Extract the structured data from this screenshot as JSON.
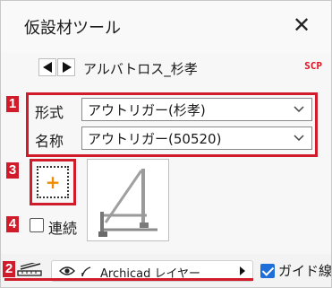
{
  "window": {
    "title": "仮設材ツール",
    "close_glyph": "✕"
  },
  "nav": {
    "item_name": "アルバトロス_杉孝",
    "scp_label": "SCP"
  },
  "markers": [
    "1",
    "2",
    "3",
    "4"
  ],
  "fields": [
    {
      "label": "形式",
      "value": "アウトリガー(杉孝)"
    },
    {
      "label": "名称",
      "value": "アウトリガー(50520)"
    }
  ],
  "add_button": {
    "glyph": "+"
  },
  "continuous": {
    "label": "連続",
    "checked": false
  },
  "bottom": {
    "layer_value": "Archicad レイヤー",
    "guide_label": "ガイド線",
    "guide_checked": true
  },
  "colors": {
    "marker_red": "#d01c2a",
    "scp_red": "#e01020",
    "add_orange": "#f08c00",
    "check_blue": "#1e6fd9"
  },
  "icons": [
    "close-icon",
    "prev-arrow-icon",
    "next-arrow-icon",
    "chevron-down-icon",
    "add-icon",
    "pencil-ruler-icon",
    "eye-icon",
    "pen-icon",
    "arrow-right-icon",
    "checkmark-icon"
  ]
}
